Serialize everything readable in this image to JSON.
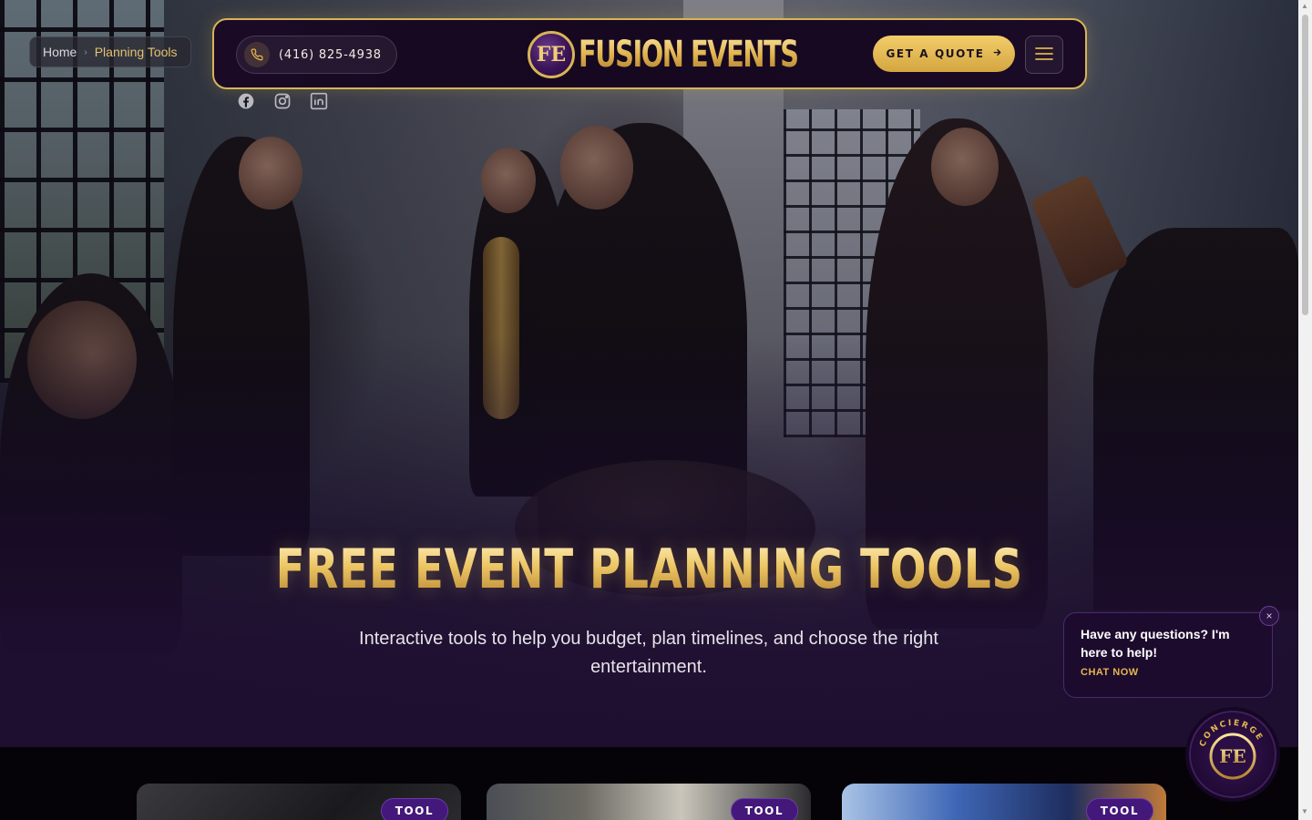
{
  "breadcrumb": {
    "home": "Home",
    "current": "Planning Tools"
  },
  "header": {
    "phone": "(416) 825-4938",
    "logo_text": "FUSION EVENTS",
    "logo_mark": "FE",
    "quote_button": "GET A QUOTE",
    "quote_icon": "arrow-right-icon",
    "menu_icon": "hamburger-menu-icon",
    "phone_icon": "phone-icon"
  },
  "social": [
    {
      "name": "facebook",
      "icon": "facebook-icon"
    },
    {
      "name": "instagram",
      "icon": "instagram-icon"
    },
    {
      "name": "linkedin",
      "icon": "linkedin-icon"
    }
  ],
  "hero": {
    "title": "FREE EVENT PLANNING TOOLS",
    "subtitle": "Interactive tools to help you budget, plan timelines, and choose the right entertainment."
  },
  "cards": [
    {
      "badge": "TOOL"
    },
    {
      "badge": "TOOL"
    },
    {
      "badge": "TOOL"
    }
  ],
  "chat": {
    "message": "Have any questions? I'm here to help!",
    "cta": "CHAT NOW",
    "close": "×",
    "widget_label": "CONCIERGE"
  },
  "colors": {
    "accent_gold": "#d8b456",
    "deep_purple": "#1a0a26",
    "badge_purple": "#43187a"
  }
}
